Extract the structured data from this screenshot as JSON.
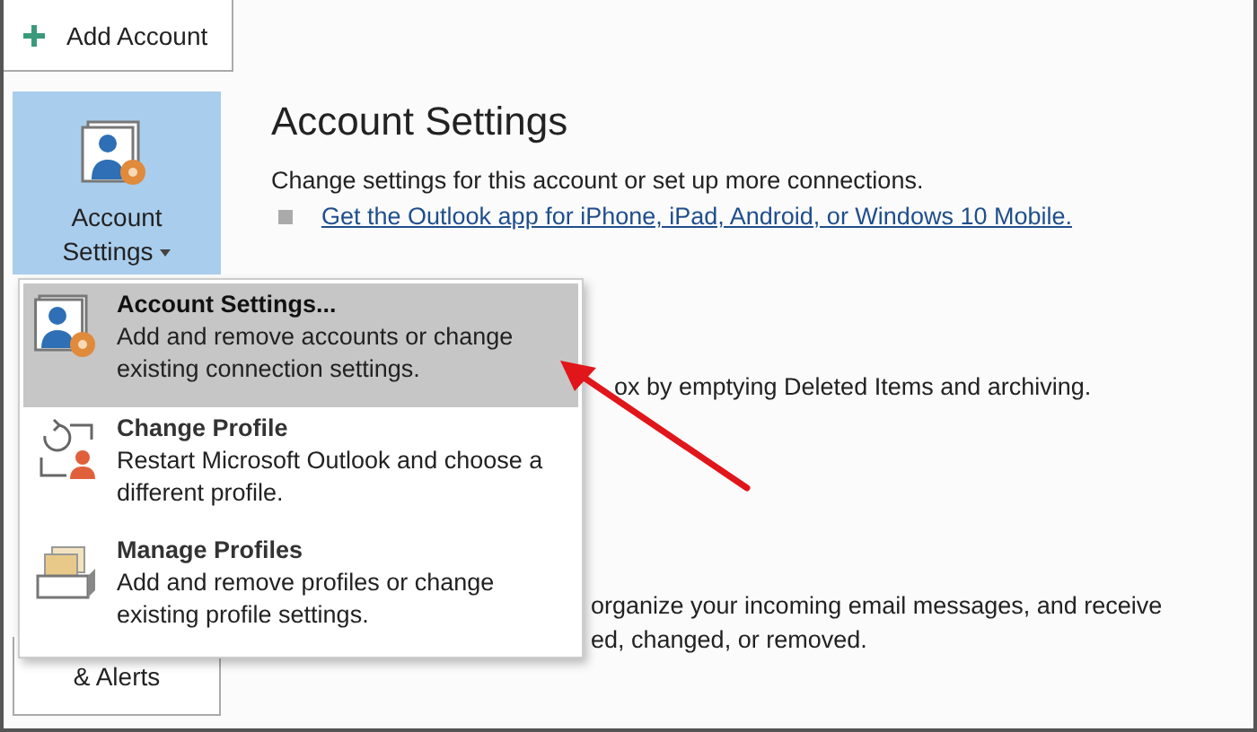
{
  "toolbar": {
    "add_account": {
      "label": "Add Account"
    }
  },
  "sidebar": {
    "tiles": [
      {
        "kind": "account",
        "label": "Account Settings",
        "dropdown": true,
        "selected": true
      },
      {
        "kind": "alerts",
        "label": "& Alerts",
        "selected": false
      }
    ]
  },
  "main": {
    "title": "Account Settings",
    "description": "Change settings for this account or set up more connections.",
    "links": [
      "Get the Outlook app for iPhone, iPad, Android, or Windows 10 Mobile."
    ],
    "fragments": [
      {
        "lines": [
          "ox by emptying Deleted Items and archiving."
        ]
      },
      {
        "lines": [
          "organize your incoming email messages, and receive",
          "ed, changed, or removed."
        ]
      }
    ]
  },
  "menu": {
    "items": [
      {
        "kind": "account",
        "title": "Account Settings...",
        "description": "Add and remove accounts or change existing connection settings.",
        "selected": true
      },
      {
        "kind": "profile",
        "title": "Change Profile",
        "description": "Restart Microsoft Outlook and choose a different profile.",
        "selected": false
      },
      {
        "kind": "profiles",
        "title": "Manage Profiles",
        "description": "Add and remove profiles or change existing profile settings.",
        "selected": false
      }
    ]
  },
  "annotation": {
    "kind": "arrow"
  }
}
